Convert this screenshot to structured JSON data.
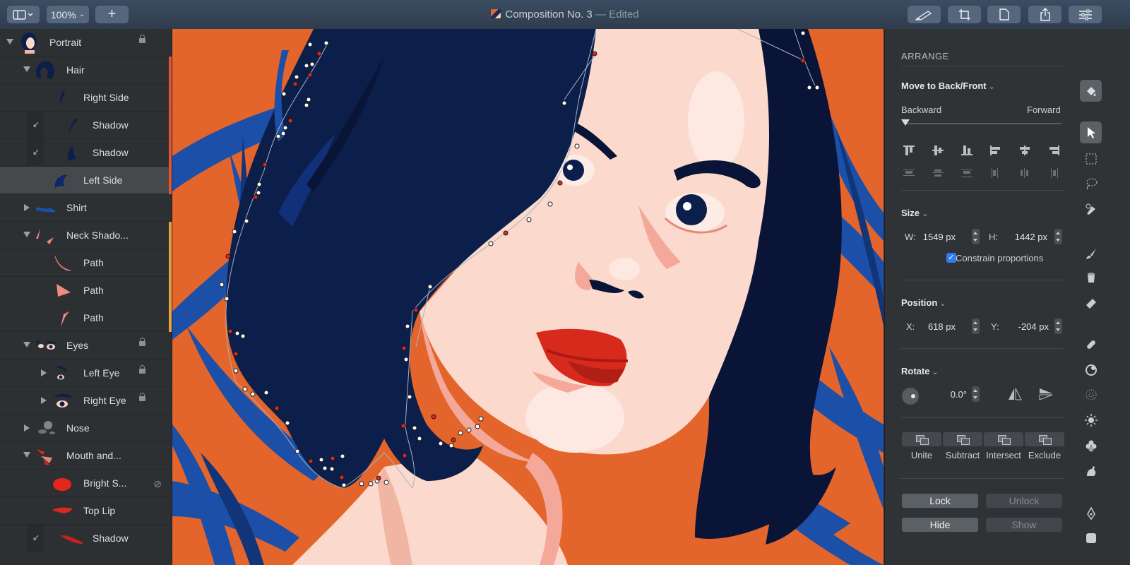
{
  "window": {
    "title": "Composition No. 3",
    "title_suffix": "— Edited",
    "zoom": "100%",
    "add_label": "+"
  },
  "layers": [
    {
      "name": "Portrait",
      "expanded": true,
      "locked": true
    },
    {
      "name": "Hair",
      "expanded": true,
      "tag_color": "#e0553a"
    },
    {
      "name": "Right Side",
      "tag_color": "#e0553a"
    },
    {
      "name": "Shadow",
      "mask": true,
      "tag_color": "#e0553a"
    },
    {
      "name": "Shadow",
      "mask": true,
      "tag_color": "#e0553a"
    },
    {
      "name": "Left Side",
      "selected": true,
      "tag_color": "#e0553a"
    },
    {
      "name": "Shirt",
      "expanded": false
    },
    {
      "name": "Neck Shado...",
      "expanded": true,
      "tag_color": "#e8a43a"
    },
    {
      "name": "Path",
      "tag_color": "#e8a43a"
    },
    {
      "name": "Path",
      "tag_color": "#e8a43a"
    },
    {
      "name": "Path",
      "tag_color": "#e8a43a"
    },
    {
      "name": "Eyes",
      "expanded": true,
      "locked": true
    },
    {
      "name": "Left Eye",
      "expanded": false,
      "locked": true
    },
    {
      "name": "Right Eye",
      "expanded": false,
      "locked": true
    },
    {
      "name": "Nose",
      "expanded": false
    },
    {
      "name": "Mouth and...",
      "expanded": true
    },
    {
      "name": "Bright S...",
      "hidden": true
    },
    {
      "name": "Top Lip"
    },
    {
      "name": "Shadow",
      "mask": true
    }
  ],
  "mask_glyph": "↙",
  "hidden_glyph": "⊘",
  "inspector": {
    "arrange_title": "ARRANGE",
    "move_label": "Move to Back/Front",
    "backward_label": "Backward",
    "forward_label": "Forward",
    "size_label": "Size",
    "width_label": "W:",
    "width_value": "1549 px",
    "height_label": "H:",
    "height_value": "1442 px",
    "constrain_label": "Constrain proportions",
    "constrain_checked": true,
    "position_label": "Position",
    "x_label": "X:",
    "x_value": "618 px",
    "y_label": "Y:",
    "y_value": "-204 px",
    "rotate_label": "Rotate",
    "rotate_value": "0.0°",
    "boolean_ops": [
      "Unite",
      "Subtract",
      "Intersect",
      "Exclude"
    ],
    "lock_label": "Lock",
    "unlock_label": "Unlock",
    "hide_label": "Hide",
    "show_label": "Show"
  },
  "tools": [
    "paint-bucket-icon",
    "pointer-icon",
    "marquee-icon",
    "lasso-icon",
    "pen-add-icon",
    "brush-icon",
    "bucket-icon",
    "eraser-icon",
    "bandage-icon",
    "blur-icon",
    "noise-icon",
    "sun-icon",
    "flower-icon",
    "smudge-icon",
    "pen-icon",
    "shape-icon"
  ],
  "colors": {
    "canvas_bg": "#e4652c",
    "hair": "#0c1e4a",
    "skin": "#fbd9cc",
    "lip": "#d8291d",
    "leaf": "#1b4fa8",
    "accent": "#2f7cf6"
  }
}
